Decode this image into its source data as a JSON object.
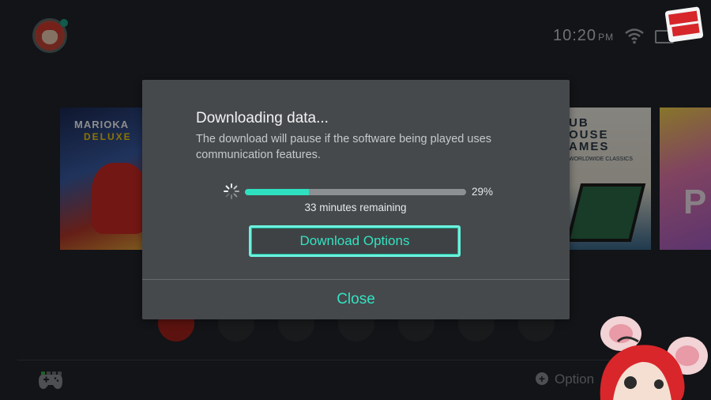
{
  "home": {
    "clock": {
      "time": "10:20",
      "ampm": "PM"
    },
    "tiles": [
      {
        "title_line1": "MARIOKA",
        "title_line2": "DELUXE"
      },
      {
        "title": "UB\nOUSE\nAMES",
        "subtitle": "WORLDWIDE CLASSICS"
      },
      {
        "title": "P"
      }
    ],
    "options_label": "Option"
  },
  "dialog": {
    "title": "Downloading data...",
    "message": "The download will pause if the software being played uses communication features.",
    "progress": {
      "percent": 29,
      "percent_label": "29%"
    },
    "remaining": "33 minutes remaining",
    "download_options_label": "Download Options",
    "close_label": "Close"
  },
  "colors": {
    "accent": "#33e2c2",
    "dialog_bg": "#46494c",
    "progress_fill": "#2fe0c0"
  },
  "icons": [
    "user-avatar-icon",
    "wifi-icon",
    "battery-icon",
    "spinner-icon",
    "controller-icon",
    "plus-icon"
  ]
}
